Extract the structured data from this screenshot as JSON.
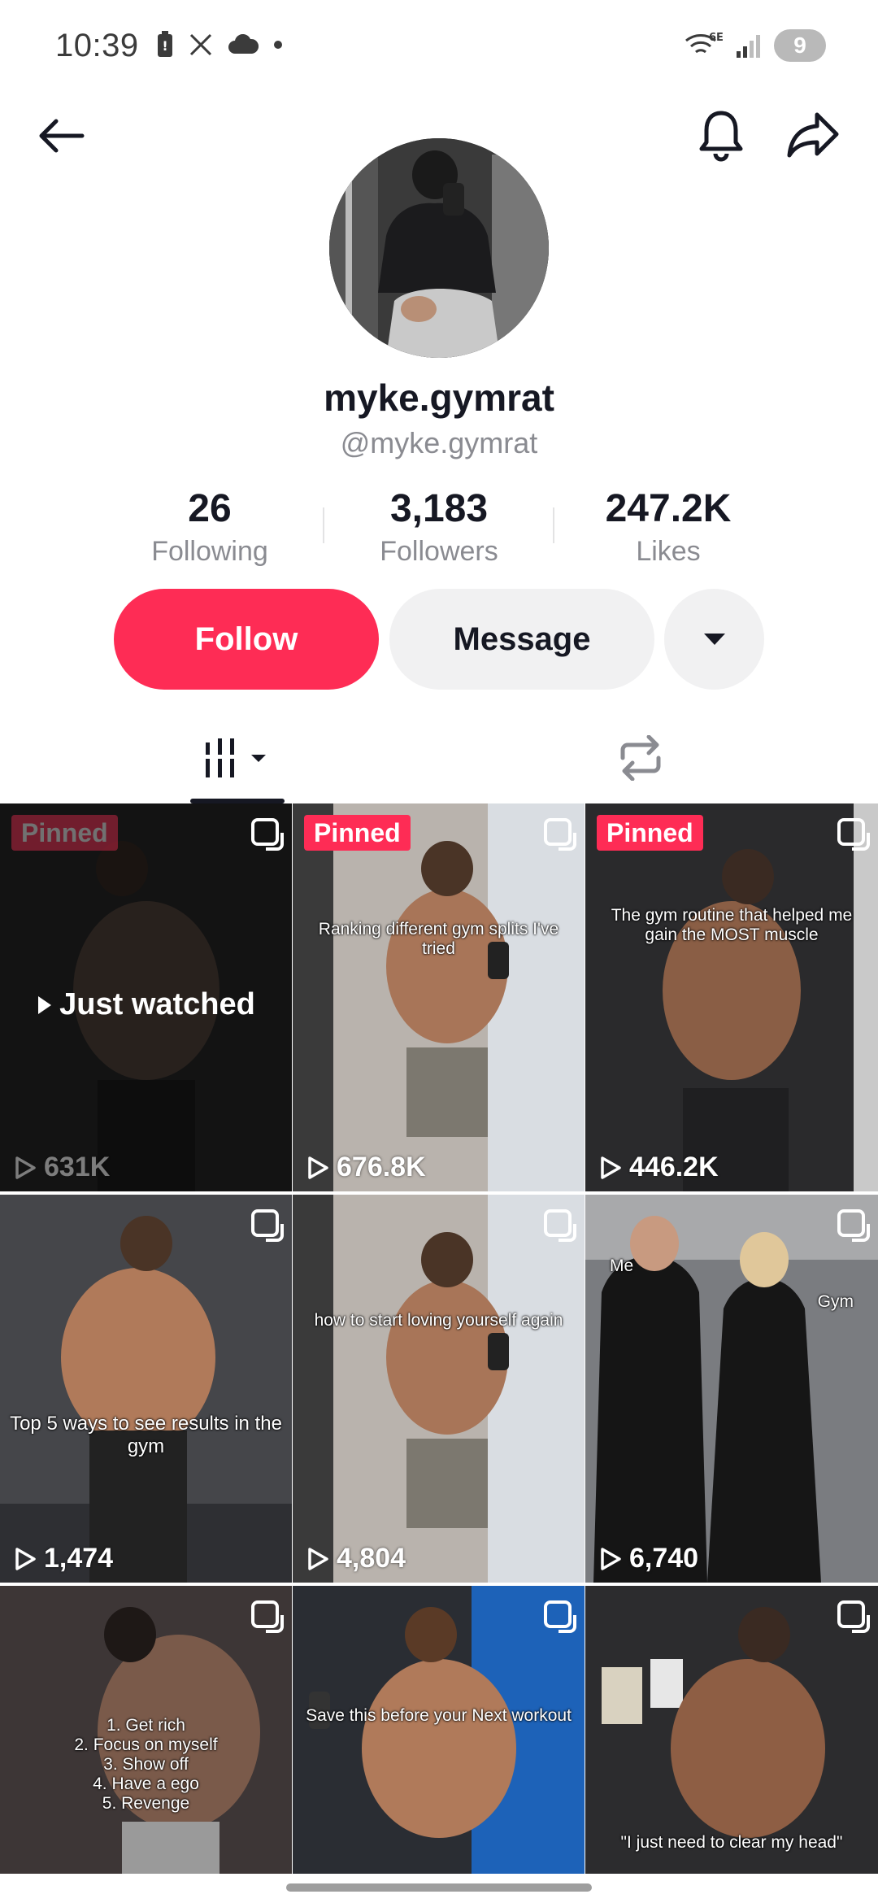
{
  "status_bar": {
    "time": "10:39",
    "network": "6E",
    "battery": "9"
  },
  "profile": {
    "display_name": "myke.gymrat",
    "username": "@myke.gymrat"
  },
  "stats": [
    {
      "value": "26",
      "label": "Following"
    },
    {
      "value": "3,183",
      "label": "Followers"
    },
    {
      "value": "247.2K",
      "label": "Likes"
    }
  ],
  "actions": {
    "follow": "Follow",
    "message": "Message"
  },
  "videos": [
    {
      "pinned": "Pinned",
      "views": "631K",
      "caption": "",
      "overlay": "Just watched",
      "bg": "#2b2b2b"
    },
    {
      "pinned": "Pinned",
      "views": "676.8K",
      "caption": "Ranking different gym splits I've tried",
      "bg": "#8a8580"
    },
    {
      "pinned": "Pinned",
      "views": "446.2K",
      "caption": "The gym routine that helped me gain the MOST muscle",
      "bg": "#4a4040"
    },
    {
      "pinned": "",
      "views": "1,474",
      "caption": "Top 5 ways to see results in the gym",
      "bg": "#3c3c3e"
    },
    {
      "pinned": "",
      "views": "4,804",
      "caption": "how to start loving yourself again",
      "bg": "#8a8580"
    },
    {
      "pinned": "",
      "views": "6,740",
      "caption": "Me",
      "caption2": "Gym",
      "bg": "#5a5c62"
    },
    {
      "pinned": "",
      "views": "",
      "caption": "1. Get rich\n2. Focus on myself\n3. Show off\n4. Have a ego\n5. Revenge",
      "bg": "#3a3434"
    },
    {
      "pinned": "",
      "views": "",
      "caption": "Save this before your Next workout",
      "bg": "#27303c"
    },
    {
      "pinned": "",
      "views": "",
      "caption": "\"I just need to clear my head\"",
      "bg": "#2f2f31"
    }
  ],
  "colors": {
    "accent": "#fe2c55",
    "text": "#161823",
    "muted": "#8a8b91",
    "button_bg": "#f1f1f2"
  }
}
